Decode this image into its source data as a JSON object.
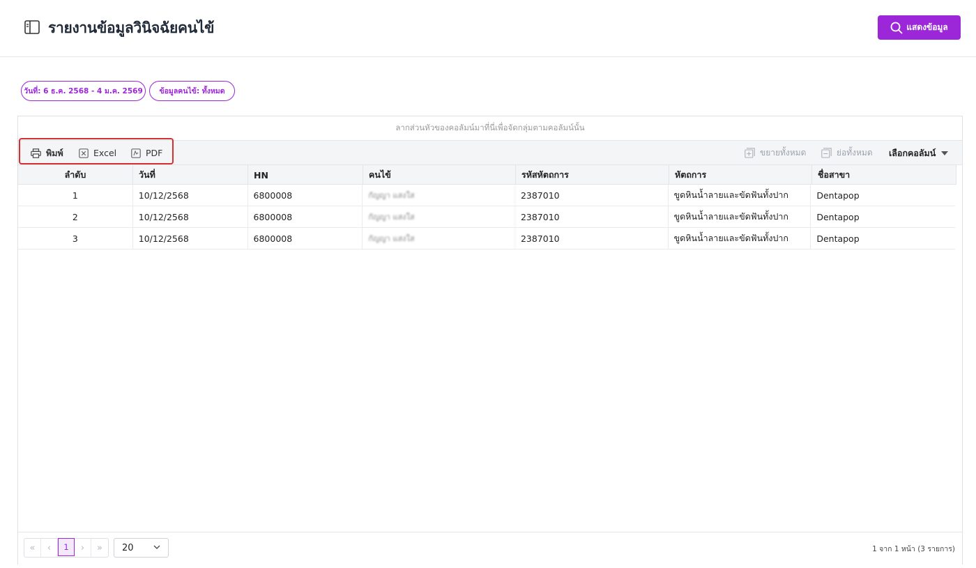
{
  "header": {
    "title": "รายงานข้อมูลวินิจฉัยคนไข้",
    "show_button": "แสดงข้อมูล"
  },
  "filters": {
    "date_chip": "วันที่: 6 ธ.ค. 2568 - 4 ม.ค. 2569",
    "patient_chip": "ข้อมูลคนไข้: ทั้งหมด"
  },
  "grid": {
    "group_panel_text": "ลากส่วนหัวของคอลัมน์มาที่นี่เพื่อจัดกลุ่มตามคอลัมน์นั้น",
    "toolbar": {
      "print": "พิมพ์",
      "excel": "Excel",
      "pdf": "PDF",
      "expand_all": "ขยายทั้งหมด",
      "collapse_all": "ย่อทั้งหมด",
      "choose_columns": "เลือกคอลัมน์"
    },
    "columns": [
      "ลำดับ",
      "วันที่",
      "HN",
      "คนไข้",
      "รหัสหัตถการ",
      "หัตถการ",
      "ชื่อสาขา"
    ],
    "rows": [
      [
        "1",
        "10/12/2568",
        "6800008",
        "กัญญา แสงใส",
        "2387010",
        "ขูดหินน้ำลายและขัดฟันทั้งปาก",
        "Dentapop"
      ],
      [
        "2",
        "10/12/2568",
        "6800008",
        "กัญญา แสงใส",
        "2387010",
        "ขูดหินน้ำลายและขัดฟันทั้งปาก",
        "Dentapop"
      ],
      [
        "3",
        "10/12/2568",
        "6800008",
        "กัญญา แสงใส",
        "2387010",
        "ขูดหินน้ำลายและขัดฟันทั้งปาก",
        "Dentapop"
      ]
    ]
  },
  "pager": {
    "first": "«",
    "prev": "‹",
    "current_page": "1",
    "next": "›",
    "last": "»",
    "page_size": "20",
    "info": "1 จาก 1 หน้า (3 รายการ)"
  },
  "colors": {
    "accent": "#9c27d9",
    "highlight_border": "#d62f2f"
  }
}
